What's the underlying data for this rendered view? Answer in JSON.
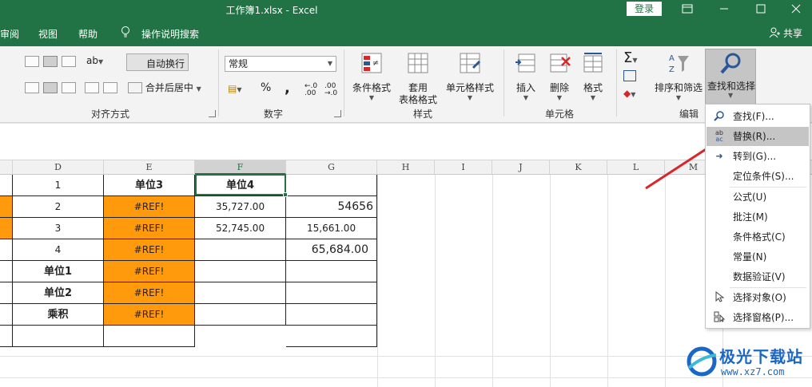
{
  "window": {
    "title": "工作簿1.xlsx  -  Excel",
    "login_label": "登录",
    "share_label": "共享"
  },
  "menu": {
    "items": [
      "审阅",
      "视图",
      "帮助"
    ],
    "tell_me": "操作说明搜索"
  },
  "ribbon": {
    "wrap_text": "自动换行",
    "merge_center": "合并后居中",
    "number_format": "常规",
    "percent": "%",
    "comma": ",",
    "buttons": {
      "conditional_format": "条件格式",
      "format_table_1": "套用",
      "format_table_2": "表格格式",
      "cell_styles": "单元格样式",
      "insert": "插入",
      "delete": "删除",
      "format": "格式",
      "sort_filter": "排序和筛选",
      "find_select": "查找和选择"
    },
    "groups": {
      "alignment": "对齐方式",
      "number": "数字",
      "styles": "样式",
      "cells": "单元格",
      "editing": "编辑"
    }
  },
  "grid": {
    "columns": [
      "D",
      "E",
      "F",
      "G",
      "H",
      "I",
      "J",
      "K",
      "L",
      "M"
    ],
    "rows": [
      [
        "1",
        "单位3",
        "单位4",
        ""
      ],
      [
        "2",
        "#REF!",
        "35,727.00",
        "54656"
      ],
      [
        "3",
        "#REF!",
        "52,745.00",
        "15,661.00"
      ],
      [
        "4",
        "#REF!",
        "",
        "65,684.00"
      ],
      [
        "单位1",
        "#REF!",
        "",
        ""
      ],
      [
        "单位2",
        "#REF!",
        "",
        ""
      ],
      [
        "乘积",
        "#REF!",
        "",
        ""
      ]
    ]
  },
  "dropdown": {
    "items": [
      {
        "label": "查找(F)...",
        "icon": "search-icon"
      },
      {
        "label": "替换(R)...",
        "icon": "replace-icon"
      },
      {
        "label": "转到(G)...",
        "icon": "goto-arrow-icon"
      },
      {
        "label": "定位条件(S)...",
        "icon": ""
      },
      {
        "label": "公式(U)",
        "icon": ""
      },
      {
        "label": "批注(M)",
        "icon": ""
      },
      {
        "label": "条件格式(C)",
        "icon": ""
      },
      {
        "label": "常量(N)",
        "icon": ""
      },
      {
        "label": "数据验证(V)",
        "icon": ""
      },
      {
        "label": "选择对象(O)",
        "icon": "cursor-icon"
      },
      {
        "label": "选择窗格(P)...",
        "icon": "selection-pane-icon"
      }
    ],
    "highlighted_index": 1
  },
  "watermark": {
    "name": "极光下载站",
    "url": "www.xz7.com"
  },
  "colors": {
    "excel_green": "#217346",
    "cell_orange": "#ff9a0d",
    "arrow_red": "#d9262a"
  }
}
